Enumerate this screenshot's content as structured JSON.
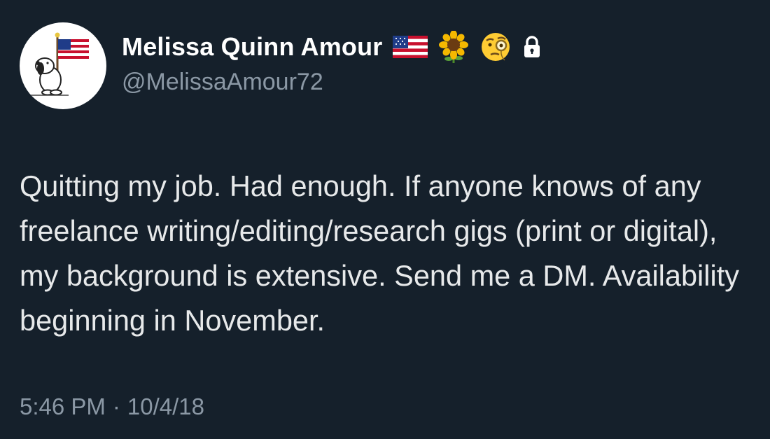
{
  "user": {
    "display_name": "Melissa Quinn Amour",
    "handle": "@MelissaAmour72",
    "badges": [
      "us-flag-icon",
      "sunflower-icon",
      "face-with-monocle-icon",
      "lock-icon"
    ],
    "avatar": "snoopy-with-flag-avatar"
  },
  "tweet": {
    "text": "Quitting my job. Had enough. If anyone knows of any freelance writing/editing/research gigs (print or digital), my background is extensive. Send me a DM. Availability beginning in November.",
    "time": "5:46 PM",
    "separator": "·",
    "date": "10/4/18"
  },
  "colors": {
    "background": "#15202b",
    "text": "#e7e9ea",
    "secondary": "#8b98a5"
  }
}
